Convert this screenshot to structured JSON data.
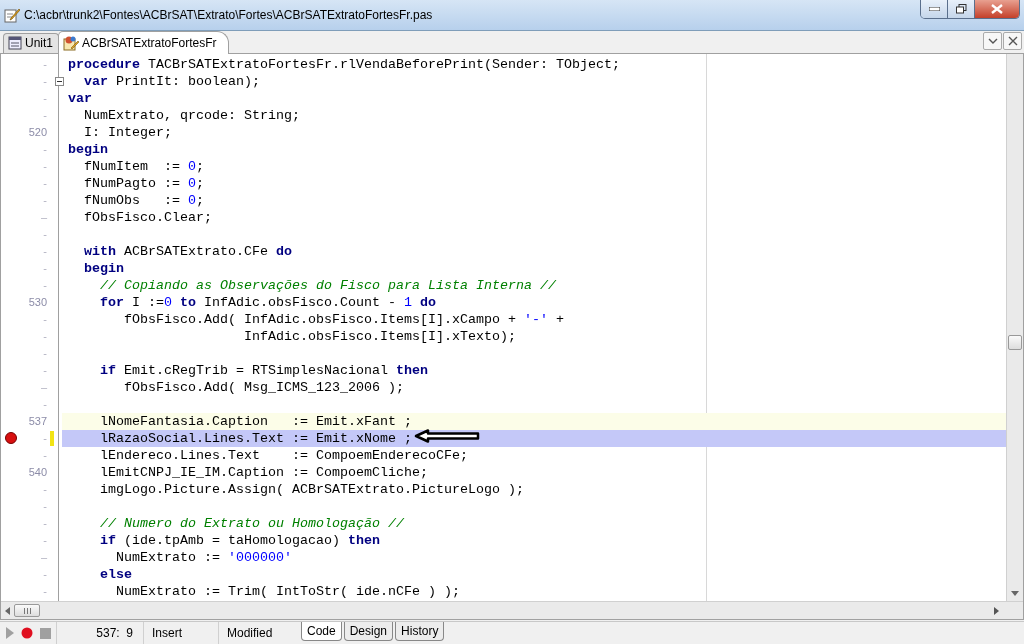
{
  "window": {
    "title": "C:\\acbr\\trunk2\\Fontes\\ACBrSAT\\Extrato\\Fortes\\ACBrSATExtratoFortesFr.pas"
  },
  "tabs": [
    {
      "label": "Unit1",
      "kind": "unit",
      "selected": false
    },
    {
      "label": "ACBrSATExtratoFortesFr",
      "kind": "form",
      "selected": true
    }
  ],
  "editor": {
    "lines": [
      {
        "gutter": "-",
        "fold": false,
        "breakpoint": false,
        "modified": false,
        "current": false,
        "segments": [
          {
            "kind": "keyword",
            "text": "procedure"
          },
          {
            "kind": "plain",
            "text": " TACBrSATExtratoFortesFr.rlVendaBeforePrint(Sender: TObject;"
          }
        ]
      },
      {
        "gutter": "-",
        "fold": true,
        "breakpoint": false,
        "modified": false,
        "current": false,
        "segments": [
          {
            "kind": "keyword",
            "text": "  var"
          },
          {
            "kind": "plain",
            "text": " PrintIt: boolean);"
          }
        ]
      },
      {
        "gutter": "-",
        "fold": false,
        "breakpoint": false,
        "modified": false,
        "current": false,
        "segments": [
          {
            "kind": "keyword",
            "text": "var"
          }
        ]
      },
      {
        "gutter": "-",
        "fold": false,
        "breakpoint": false,
        "modified": false,
        "current": false,
        "segments": [
          {
            "kind": "plain",
            "text": "  NumExtrato, qrcode: String;"
          }
        ]
      },
      {
        "gutter": "520",
        "fold": false,
        "breakpoint": false,
        "modified": false,
        "current": false,
        "segments": [
          {
            "kind": "plain",
            "text": "  I: Integer;"
          }
        ]
      },
      {
        "gutter": "-",
        "fold": false,
        "breakpoint": false,
        "modified": false,
        "current": false,
        "segments": [
          {
            "kind": "keyword",
            "text": "begin"
          }
        ]
      },
      {
        "gutter": "-",
        "fold": false,
        "breakpoint": false,
        "modified": false,
        "current": false,
        "segments": [
          {
            "kind": "plain",
            "text": "  fNumItem  := "
          },
          {
            "kind": "number",
            "text": "0"
          },
          {
            "kind": "plain",
            "text": ";"
          }
        ]
      },
      {
        "gutter": "-",
        "fold": false,
        "breakpoint": false,
        "modified": false,
        "current": false,
        "segments": [
          {
            "kind": "plain",
            "text": "  fNumPagto := "
          },
          {
            "kind": "number",
            "text": "0"
          },
          {
            "kind": "plain",
            "text": ";"
          }
        ]
      },
      {
        "gutter": "-",
        "fold": false,
        "breakpoint": false,
        "modified": false,
        "current": false,
        "segments": [
          {
            "kind": "plain",
            "text": "  fNumObs   := "
          },
          {
            "kind": "number",
            "text": "0"
          },
          {
            "kind": "plain",
            "text": ";"
          }
        ]
      },
      {
        "gutter": "–",
        "fold": false,
        "breakpoint": false,
        "modified": false,
        "current": false,
        "segments": [
          {
            "kind": "plain",
            "text": "  fObsFisco.Clear;"
          }
        ]
      },
      {
        "gutter": "-",
        "fold": false,
        "breakpoint": false,
        "modified": false,
        "current": false
      },
      {
        "gutter": "-",
        "fold": false,
        "breakpoint": false,
        "modified": false,
        "current": false,
        "segments": [
          {
            "kind": "keyword",
            "text": "  with"
          },
          {
            "kind": "plain",
            "text": " ACBrSATExtrato.CFe "
          },
          {
            "kind": "keyword",
            "text": "do"
          }
        ]
      },
      {
        "gutter": "-",
        "fold": false,
        "breakpoint": false,
        "modified": false,
        "current": false,
        "segments": [
          {
            "kind": "keyword",
            "text": "  begin"
          }
        ]
      },
      {
        "gutter": "-",
        "fold": false,
        "breakpoint": false,
        "modified": false,
        "current": false,
        "segments": [
          {
            "kind": "comment",
            "text": "    // Copiando as Observações do Fisco para Lista Interna //"
          }
        ]
      },
      {
        "gutter": "530",
        "fold": false,
        "breakpoint": false,
        "modified": false,
        "current": false,
        "segments": [
          {
            "kind": "keyword",
            "text": "    for"
          },
          {
            "kind": "plain",
            "text": " I :="
          },
          {
            "kind": "number",
            "text": "0"
          },
          {
            "kind": "keyword",
            "text": " to"
          },
          {
            "kind": "plain",
            "text": " InfAdic.obsFisco.Count - "
          },
          {
            "kind": "number",
            "text": "1"
          },
          {
            "kind": "keyword",
            "text": " do"
          }
        ]
      },
      {
        "gutter": "-",
        "fold": false,
        "breakpoint": false,
        "modified": false,
        "current": false,
        "segments": [
          {
            "kind": "plain",
            "text": "       fObsFisco.Add( InfAdic.obsFisco.Items[I].xCampo + "
          },
          {
            "kind": "string",
            "text": "'-'"
          },
          {
            "kind": "plain",
            "text": " +"
          }
        ]
      },
      {
        "gutter": "-",
        "fold": false,
        "breakpoint": false,
        "modified": false,
        "current": false,
        "segments": [
          {
            "kind": "plain",
            "text": "                      InfAdic.obsFisco.Items[I].xTexto);"
          }
        ]
      },
      {
        "gutter": "-",
        "fold": false,
        "breakpoint": false,
        "modified": false,
        "current": false
      },
      {
        "gutter": "-",
        "fold": false,
        "breakpoint": false,
        "modified": false,
        "current": false,
        "segments": [
          {
            "kind": "keyword",
            "text": "    if"
          },
          {
            "kind": "plain",
            "text": " Emit.cRegTrib = RTSimplesNacional "
          },
          {
            "kind": "keyword",
            "text": "then"
          }
        ]
      },
      {
        "gutter": "–",
        "fold": false,
        "breakpoint": false,
        "modified": false,
        "current": false,
        "segments": [
          {
            "kind": "plain",
            "text": "       fObsFisco.Add( Msg_ICMS_123_2006 );"
          }
        ]
      },
      {
        "gutter": "-",
        "fold": false,
        "breakpoint": false,
        "modified": false,
        "current": false
      },
      {
        "gutter": "537",
        "fold": false,
        "breakpoint": false,
        "modified": false,
        "current": true,
        "segments": [
          {
            "kind": "plain",
            "text": "    lNomeFantasia.Caption   := Emit.xFant ;"
          }
        ]
      },
      {
        "gutter": "-",
        "fold": false,
        "breakpoint": true,
        "modified": true,
        "current": false,
        "segments": [
          {
            "kind": "plain",
            "text": "    lRazaoSocial.Lines.Text := Emit.xNome ;"
          }
        ]
      },
      {
        "gutter": "-",
        "fold": false,
        "breakpoint": false,
        "modified": false,
        "current": false,
        "segments": [
          {
            "kind": "plain",
            "text": "    lEndereco.Lines.Text    := CompoemEnderecoCFe;"
          }
        ]
      },
      {
        "gutter": "540",
        "fold": false,
        "breakpoint": false,
        "modified": false,
        "current": false,
        "segments": [
          {
            "kind": "plain",
            "text": "    lEmitCNPJ_IE_IM.Caption := CompoemCliche;"
          }
        ]
      },
      {
        "gutter": "-",
        "fold": false,
        "breakpoint": false,
        "modified": false,
        "current": false,
        "segments": [
          {
            "kind": "plain",
            "text": "    imgLogo.Picture.Assign( ACBrSATExtrato.PictureLogo );"
          }
        ]
      },
      {
        "gutter": "-",
        "fold": false,
        "breakpoint": false,
        "modified": false,
        "current": false
      },
      {
        "gutter": "-",
        "fold": false,
        "breakpoint": false,
        "modified": false,
        "current": false,
        "segments": [
          {
            "kind": "comment",
            "text": "    // Numero do Extrato ou Homologação //"
          }
        ]
      },
      {
        "gutter": "-",
        "fold": false,
        "breakpoint": false,
        "modified": false,
        "current": false,
        "segments": [
          {
            "kind": "keyword",
            "text": "    if"
          },
          {
            "kind": "plain",
            "text": " (ide.tpAmb = taHomologacao) "
          },
          {
            "kind": "keyword",
            "text": "then"
          }
        ]
      },
      {
        "gutter": "–",
        "fold": false,
        "breakpoint": false,
        "modified": false,
        "current": false,
        "segments": [
          {
            "kind": "plain",
            "text": "      NumExtrato := "
          },
          {
            "kind": "string",
            "text": "'000000'"
          }
        ]
      },
      {
        "gutter": "-",
        "fold": false,
        "breakpoint": false,
        "modified": false,
        "current": false,
        "segments": [
          {
            "kind": "keyword",
            "text": "    else"
          }
        ]
      },
      {
        "gutter": "-",
        "fold": false,
        "breakpoint": false,
        "modified": false,
        "current": false,
        "segments": [
          {
            "kind": "plain",
            "text": "      NumExtrato := Trim( IntToStr( ide.nCFe ) );"
          }
        ]
      }
    ]
  },
  "status_bar": {
    "position": "537:  9",
    "mode": "Insert",
    "state": "Modified",
    "view_tabs": [
      {
        "label": "Code",
        "selected": true
      },
      {
        "label": "Design",
        "selected": false
      },
      {
        "label": "History",
        "selected": false
      }
    ]
  }
}
